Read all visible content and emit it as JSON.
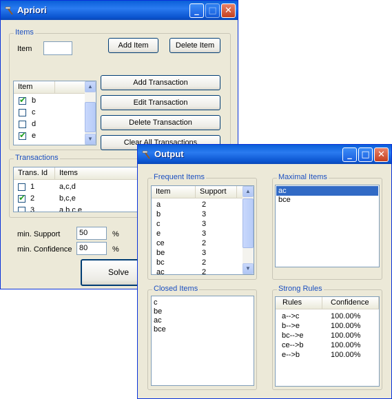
{
  "apriori": {
    "title": "Apriori",
    "items_group": "Items",
    "item_label": "Item",
    "item_value": "",
    "add_item": "Add Item",
    "delete_item": "Delete Item",
    "item_list_header": "Item",
    "item_rows": [
      {
        "label": "b",
        "checked": true
      },
      {
        "label": "c",
        "checked": false
      },
      {
        "label": "d",
        "checked": false
      },
      {
        "label": "e",
        "checked": true
      }
    ],
    "add_transaction": "Add Transaction",
    "edit_transaction": "Edit Transaction",
    "delete_transaction": "Delete Transaction",
    "clear_all": "Clear All Transactions",
    "transactions_group": "Transactions",
    "trans_headers": [
      "Trans. Id",
      "Items"
    ],
    "trans_rows": [
      {
        "id": "1",
        "items": "a,c,d",
        "checked": false
      },
      {
        "id": "2",
        "items": "b,c,e",
        "checked": true
      },
      {
        "id": "3",
        "items": "a,b,c,e",
        "checked": false
      }
    ],
    "min_support_label": "min. Support",
    "min_support": "50",
    "min_conf_label": "min. Confidence",
    "min_conf": "80",
    "percent": "%",
    "solve": "Solve"
  },
  "output": {
    "title": "Output",
    "frequent_group": "Frequent Items",
    "frequent_headers": [
      "Item",
      "Support"
    ],
    "frequent_rows": [
      [
        "a",
        "2"
      ],
      [
        "b",
        "3"
      ],
      [
        "c",
        "3"
      ],
      [
        "e",
        "3"
      ],
      [
        "ce",
        "2"
      ],
      [
        "be",
        "3"
      ],
      [
        "bc",
        "2"
      ],
      [
        "ac",
        "2"
      ]
    ],
    "maximal_group": "Maximal Items",
    "maximal_items": [
      "ac",
      "bce"
    ],
    "maximal_selected": 0,
    "closed_group": "Closed Items",
    "closed_items": [
      "c",
      "be",
      "ac",
      "bce"
    ],
    "rules_group": "Strong Rules",
    "rules_headers": [
      "Rules",
      "Confidence"
    ],
    "rules_rows": [
      [
        "a-->c",
        "100.00%"
      ],
      [
        "b-->e",
        "100.00%"
      ],
      [
        "bc-->e",
        "100.00%"
      ],
      [
        "ce-->b",
        "100.00%"
      ],
      [
        "e-->b",
        "100.00%"
      ]
    ]
  },
  "colors": {
    "titlebar": "#0a5fd8",
    "window_bg": "#ece9d8",
    "group_label": "#1b4fc0",
    "selection": "#316ac5"
  },
  "icons": {
    "app": "hammer-icon",
    "minimize": "minimize-icon",
    "maximize": "maximize-icon",
    "close": "close-icon"
  }
}
